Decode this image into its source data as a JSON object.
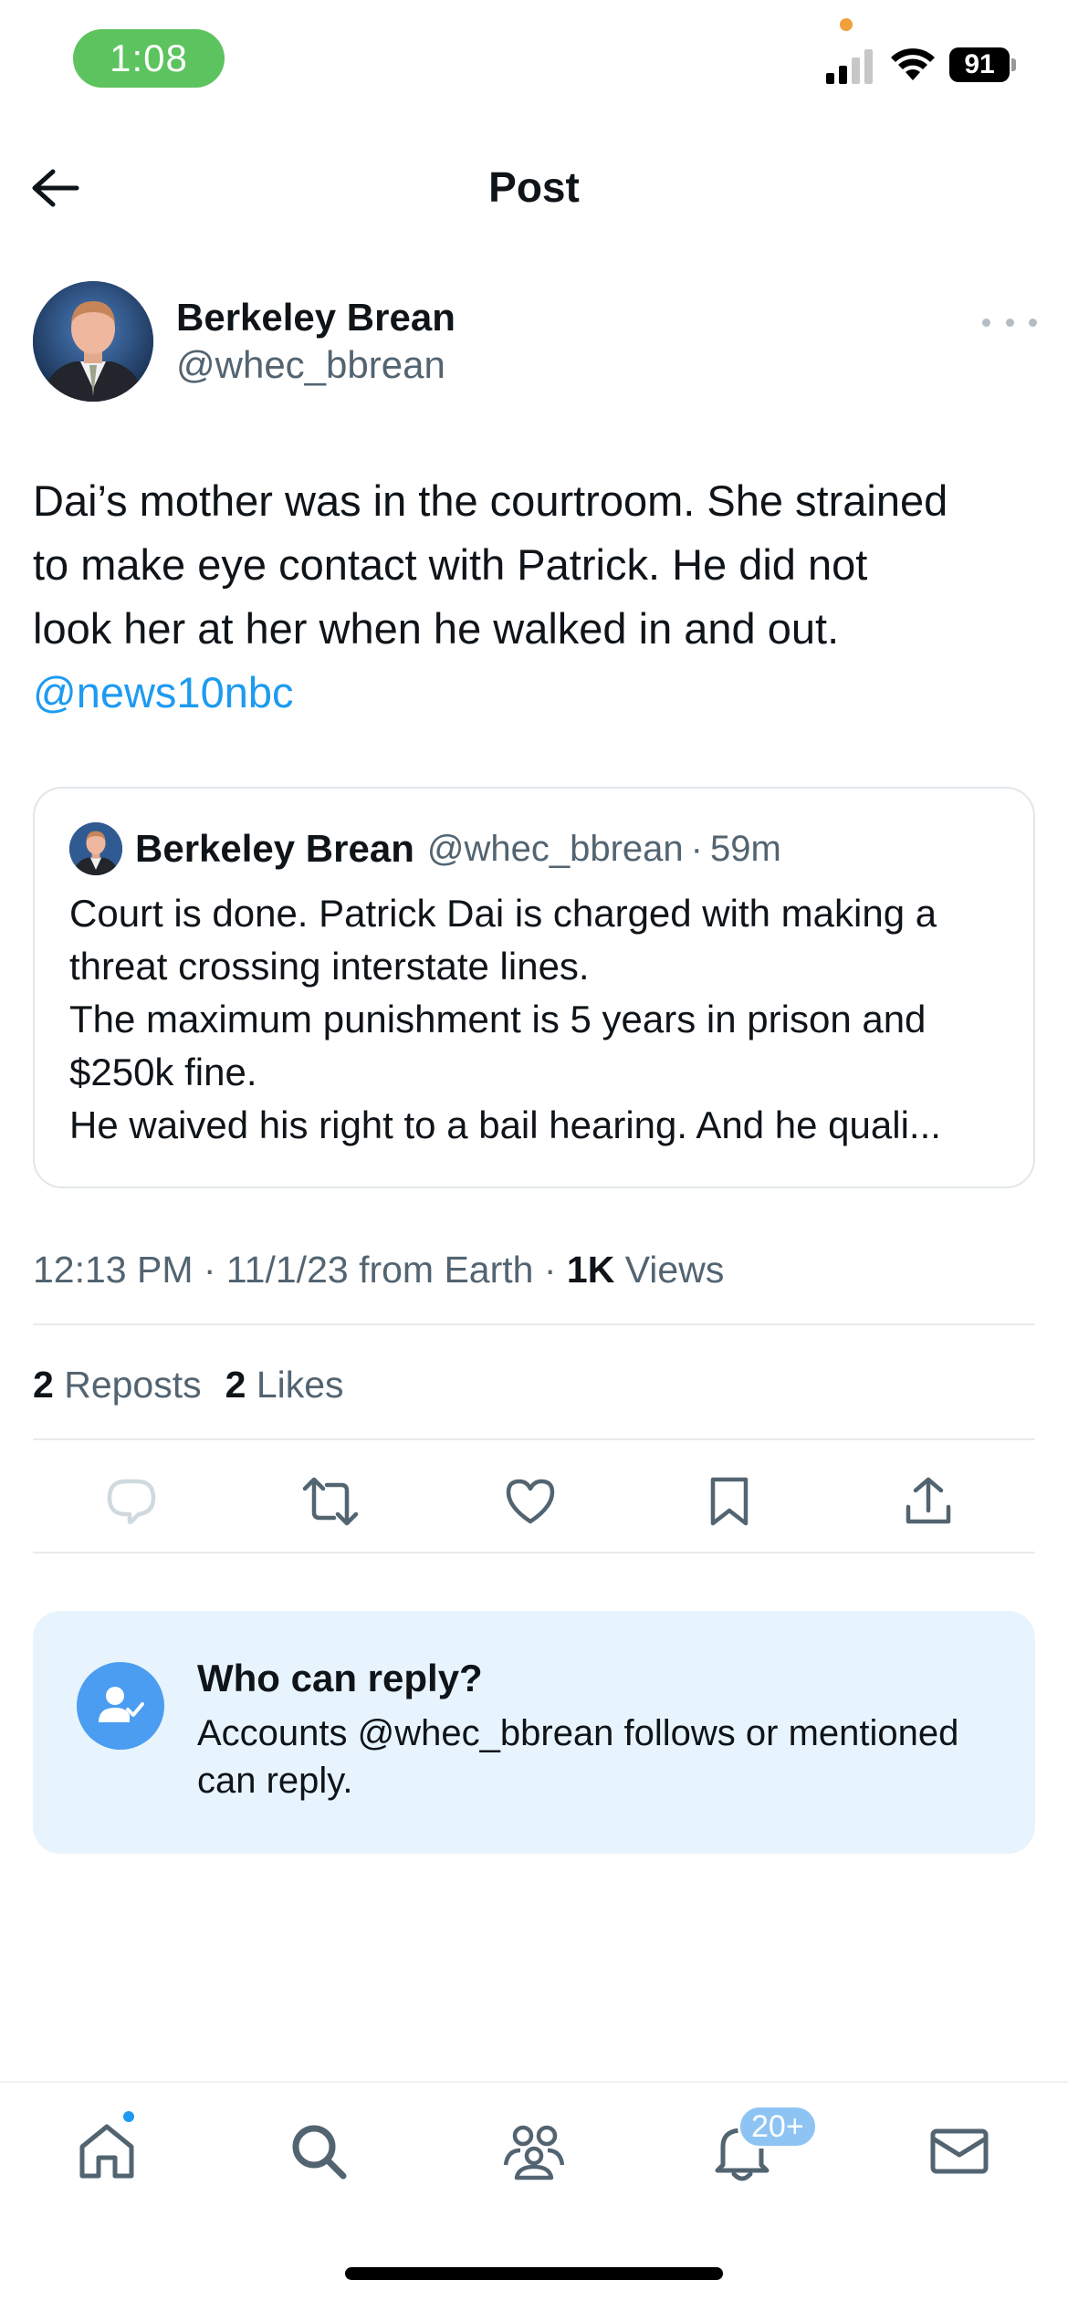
{
  "status_bar": {
    "time": "1:08",
    "battery": "91",
    "time_pill_color": "#5cc35e"
  },
  "header": {
    "title": "Post",
    "back_icon": "arrow-left-icon"
  },
  "post": {
    "author_name": "Berkeley Brean",
    "author_handle": "@whec_bbrean",
    "text_lines": [
      "Dai’s mother was in the courtroom. She strained",
      "to make eye contact with Patrick. He did not",
      "look her at her when he walked in and out."
    ],
    "mention": "@news10nbc",
    "timestamp": "12:13 PM · 11/1/23 from Earth · ",
    "views_count": "1K",
    "views_label": " Views",
    "reposts_count": "2",
    "reposts_label": " Reposts",
    "likes_count": "2",
    "likes_label": " Likes"
  },
  "quote": {
    "author_name": "Berkeley Brean",
    "author_handle": "@whec_bbrean",
    "separator": "·",
    "time_ago": "59m",
    "lines": [
      "Court is done. Patrick Dai is charged with making a",
      "threat crossing interstate lines.",
      "The maximum punishment is 5 years in prison and",
      "$250k fine.",
      "He waived his right to a bail hearing. And he quali..."
    ]
  },
  "actions": [
    "reply-icon",
    "repost-icon",
    "like-icon",
    "bookmark-icon",
    "share-icon"
  ],
  "reply_settings": {
    "title": "Who can reply?",
    "description": "Accounts @whec_bbrean follows or mentioned can reply."
  },
  "bottom_nav": {
    "items": [
      "home-icon",
      "search-icon",
      "communities-icon",
      "notifications-icon",
      "messages-icon"
    ],
    "notifications_badge": "20+"
  },
  "colors": {
    "accent": "#1d9bf0",
    "secondary_text": "#536471",
    "reply_card_bg": "#e8f4fd"
  }
}
